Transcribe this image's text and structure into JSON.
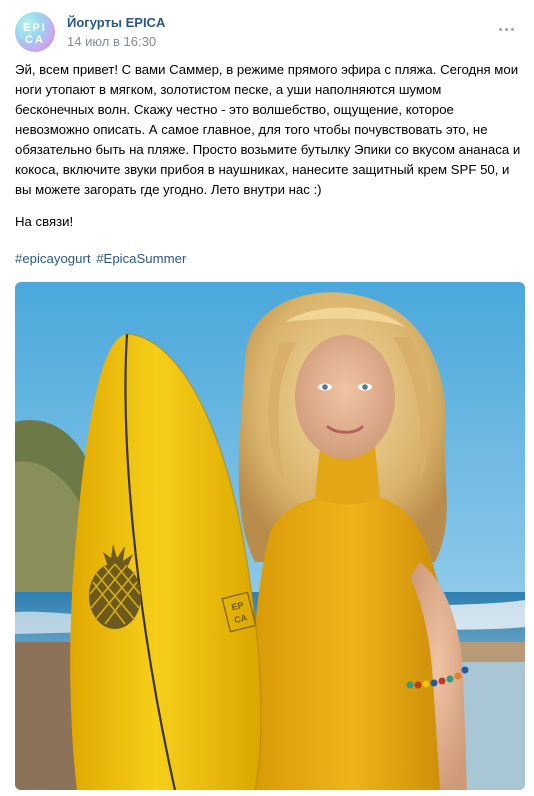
{
  "post": {
    "author": "Йогурты EPICA",
    "date": "14 июл в 16:30",
    "body": "Эй, всем привет! С вами Саммер, в режиме прямого эфира с пляжа. Сегодня мои\nноги утопают в мягком, золотистом песке, а уши наполняются шумом\nбесконечных волн. Скажу честно - это волшебство, ощущение, которое\nневозможно описать. А самое главное, для того чтобы почувствовать это, не\nобязательно быть на пляже. Просто возьмите бутылку Эпики со вкусом ананаса и\nкокоса, включите звуки прибоя в наушниках, нанесите защитный крем SPF 50, и\nвы можете загорать где угодно. Лето внутри нас :)",
    "greeting": "На связи!",
    "hashtags": [
      "#epicayogurt",
      "#EpicaSummer"
    ],
    "avatar_text": "EPICA",
    "board_logo": "EPICA"
  },
  "icons": {
    "more": "more-horizontal-icon",
    "pineapple": "pineapple-icon"
  },
  "colors": {
    "link": "#2a5885",
    "meta": "#818c99",
    "surfboard": "#f2c20f",
    "swimsuit": "#e8a810",
    "sky": "#8cc8e8"
  }
}
